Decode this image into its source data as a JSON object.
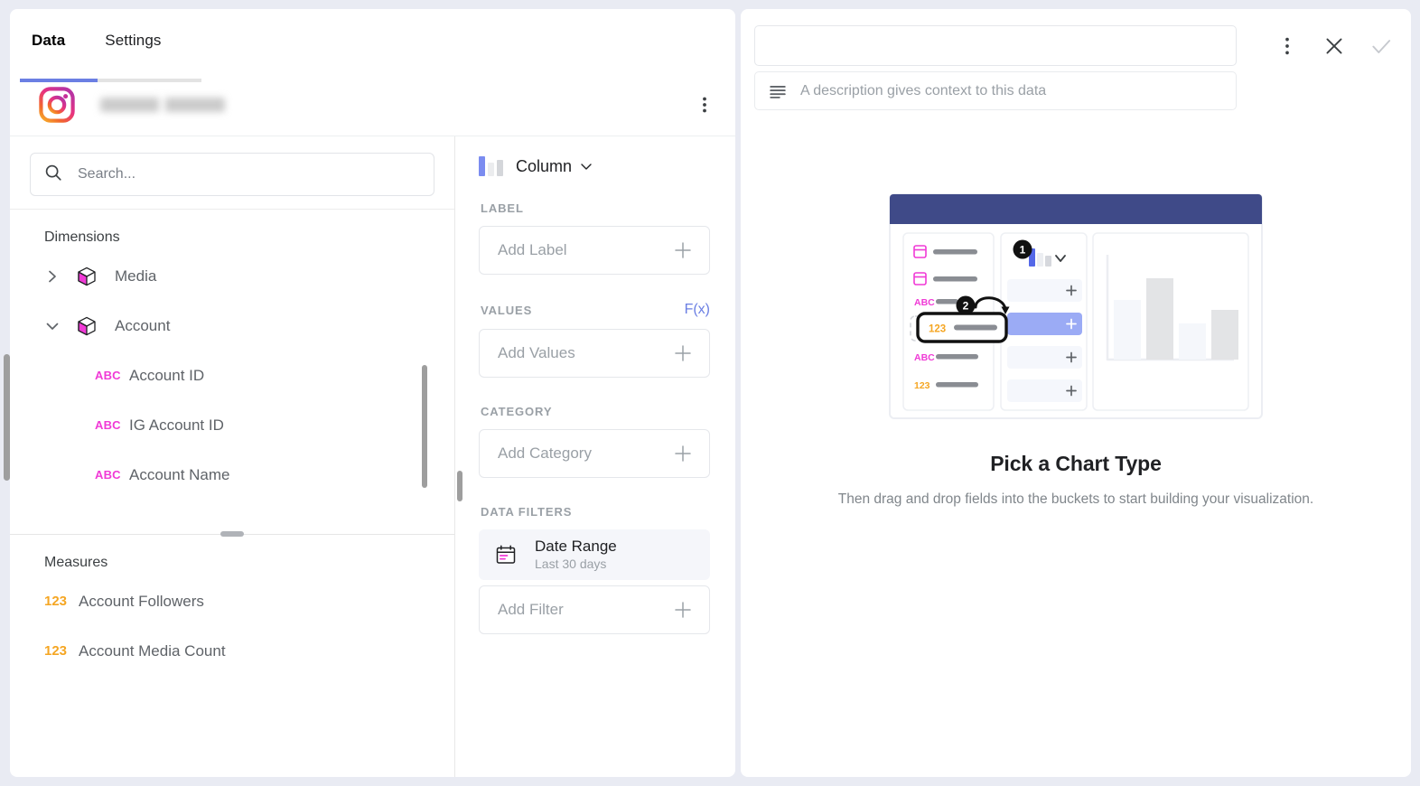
{
  "tabs": [
    {
      "label": "Data",
      "active": true
    },
    {
      "label": "Settings",
      "active": false
    }
  ],
  "source": {
    "icon": "instagram-icon",
    "account_name": "",
    "menu_icon": "kebab-menu-icon"
  },
  "search": {
    "placeholder": "Search...",
    "value": "",
    "icon": "search-icon"
  },
  "fields": {
    "dimensions_title": "Dimensions",
    "measures_title": "Measures",
    "groups": [
      {
        "label": "Media",
        "expanded": false,
        "icon": "cube-icon",
        "chevron": "chevron-right-icon",
        "fields": []
      },
      {
        "label": "Account",
        "expanded": true,
        "icon": "cube-icon",
        "chevron": "chevron-down-icon",
        "fields": [
          {
            "label": "Account ID",
            "type": "ABC"
          },
          {
            "label": "IG Account ID",
            "type": "ABC"
          },
          {
            "label": "Account Name",
            "type": "ABC"
          }
        ]
      }
    ],
    "measures": [
      {
        "label": "Account Followers",
        "type": "123"
      },
      {
        "label": "Account Media Count",
        "type": "123"
      }
    ]
  },
  "buckets": {
    "chart_type": {
      "label": "Column",
      "caret": "chevron-down-icon",
      "icon": "column-chart-icon"
    },
    "sections": [
      {
        "title": "LABEL",
        "placeholder": "Add Label",
        "action": ""
      },
      {
        "title": "VALUES",
        "placeholder": "Add Values",
        "action": "F(x)"
      },
      {
        "title": "CATEGORY",
        "placeholder": "Add Category",
        "action": ""
      },
      {
        "title": "DATA FILTERS",
        "placeholder": "Add Filter",
        "action": ""
      }
    ],
    "filter_chip": {
      "title": "Date Range",
      "subtitle": "Last 30 days",
      "icon": "calendar-icon"
    }
  },
  "right_panel": {
    "title_value": "",
    "title_placeholder": "",
    "description_placeholder": "A description gives context to this data",
    "description_value": "",
    "description_icon": "description-lines-icon",
    "actions": [
      {
        "name": "more-options",
        "icon": "kebab-menu-icon",
        "enabled": true
      },
      {
        "name": "close",
        "icon": "close-x-icon",
        "enabled": true
      },
      {
        "name": "confirm",
        "icon": "checkmark-icon",
        "enabled": false
      }
    ],
    "empty_state": {
      "title": "Pick a Chart Type",
      "subtitle": "Then drag and drop fields into the buckets to start building your visualization.",
      "illustration": {
        "badges": [
          "1",
          "2"
        ],
        "header_color": "#3f4a88",
        "dragged_field_type": "123",
        "bars": [
          66,
          90,
          40,
          55
        ]
      }
    }
  },
  "colors": {
    "accent": "#6b7fe3",
    "dimension": "#f03ad6",
    "measure": "#f5a623",
    "page_bg": "#e9ebf3"
  }
}
